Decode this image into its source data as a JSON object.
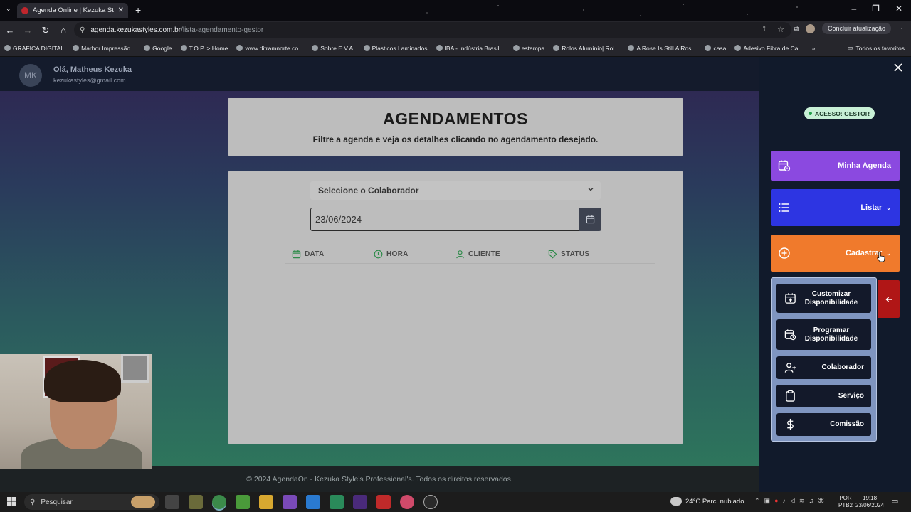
{
  "browser": {
    "tab_title": "Agenda Online | Kezuka Style's",
    "url_host": "agenda.kezukastyles.com.br",
    "url_path": "/lista-agendamento-gestor",
    "update_label": "Concluir atualização",
    "bookmarks": [
      "GRAFICA DIGITAL",
      "Marbor Impressão...",
      "Google",
      "T.O.P. > Home",
      "www.ditramnorte.co...",
      "Sobre E.V.A.",
      "Plasticos Laminados",
      "IBA - Indústria Brasil...",
      "estampa",
      "Rolos Alumínio| Rol...",
      "A Rose Is Still A Ros...",
      "casa",
      "Adesivo Fibra de Ca..."
    ],
    "bookmarks_all": "Todos os favoritos"
  },
  "header": {
    "avatar_initials": "MK",
    "greeting": "Olá,  Matheus Kezuka",
    "email": "kezukastyles@gmail.com"
  },
  "main": {
    "title": "AGENDAMENTOS",
    "subtitle": "Filtre a agenda e veja os detalhes clicando no agendamento desejado.",
    "select_label": "Selecione o Colaborador",
    "date_value": "23/06/2024",
    "columns": [
      "DATA",
      "HORA",
      "CLIENTE",
      "STATUS"
    ]
  },
  "footer": {
    "text": "© 2024 AgendaOn - Kezuka Style's Professional's. Todos os direitos reservados."
  },
  "panel": {
    "badge": "ACESSO: GESTOR",
    "menu": {
      "agenda": "Minha Agenda",
      "listar": "Listar",
      "cadastrar": "Cadastrar"
    },
    "submenu": {
      "customizar": "Customizar Disponibilidade",
      "programar": "Programar Disponibilidade",
      "colaborador": "Colaborador",
      "servico": "Serviço",
      "comissao": "Comissão"
    }
  },
  "taskbar": {
    "search": "Pesquisar",
    "weather": "24°C  Parc. nublado",
    "lang1": "POR",
    "lang2": "PTB2",
    "time": "19:18",
    "date": "23/06/2024"
  },
  "colors": {
    "agenda": "#8b49e0",
    "listar": "#2d35e2",
    "cadastrar": "#f07a2c",
    "accent_green": "#2e8b4a"
  }
}
